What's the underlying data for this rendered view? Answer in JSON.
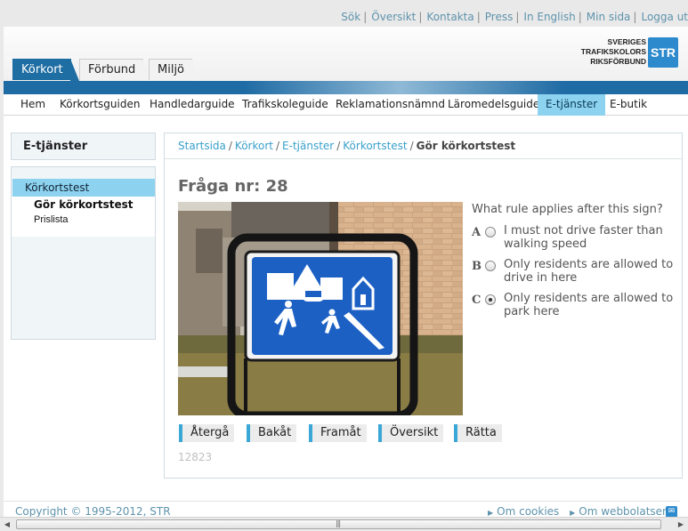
{
  "utility_nav": {
    "links": [
      "Sök",
      "Översikt",
      "Kontakta",
      "Press",
      "In English",
      "Min sida",
      "Logga ut"
    ],
    "separator": "|"
  },
  "top_tabs": [
    {
      "label": "Körkort",
      "active": true
    },
    {
      "label": "Förbund",
      "active": false
    },
    {
      "label": "Miljö",
      "active": false
    }
  ],
  "logo": {
    "line1": "SVERIGES",
    "line2": "TRAFIKSKOLORS",
    "line3": "RIKSFÖRBUND",
    "mark": "STR",
    "brand_color": "#2d8bcd"
  },
  "main_nav": {
    "items": [
      {
        "label": "Hem",
        "active": false
      },
      {
        "label": "Körkortsguiden",
        "active": false
      },
      {
        "label": "Handledarguide",
        "active": false
      },
      {
        "label": "Trafikskoleguide",
        "active": false
      },
      {
        "label": "Reklamationsnämnd",
        "active": false
      },
      {
        "label": "Läromedelsguide",
        "active": false
      },
      {
        "label": "E-tjänster",
        "active": true
      },
      {
        "label": "E-butik",
        "active": false
      }
    ]
  },
  "sidebar": {
    "title": "E-tjänster",
    "active_item": "Körkortstest",
    "sub_items": [
      "Gör körkortstest",
      "Prislista"
    ]
  },
  "breadcrumb": {
    "links": [
      "Startsida",
      "Körkort",
      "E-tjänster",
      "Körkortstest"
    ],
    "current": "Gör körkortstest",
    "separator": "/"
  },
  "quiz": {
    "title": "Fråga nr: 28",
    "image_alt": "sign-photo",
    "question": "What rule applies after this sign?",
    "answers": [
      {
        "letter": "A",
        "text": "I must not drive faster than walking speed",
        "selected": false
      },
      {
        "letter": "B",
        "text": "Only residents are allowed to drive in here",
        "selected": false
      },
      {
        "letter": "C",
        "text": "Only residents are allowed to park here",
        "selected": true
      }
    ],
    "buttons": [
      "Återgå",
      "Bakåt",
      "Framåt",
      "Översikt",
      "Rätta"
    ],
    "question_id": "12823"
  },
  "footer": {
    "copyright": "Copyright © 1995-2012, STR",
    "links": [
      "Om cookies",
      "Om webbolatsen"
    ]
  },
  "colors": {
    "accent_blue": "#1e6da3",
    "highlight": "#8dd3f0",
    "link": "#3aa0cc"
  },
  "icons": {
    "scroll_grip": "|||"
  }
}
